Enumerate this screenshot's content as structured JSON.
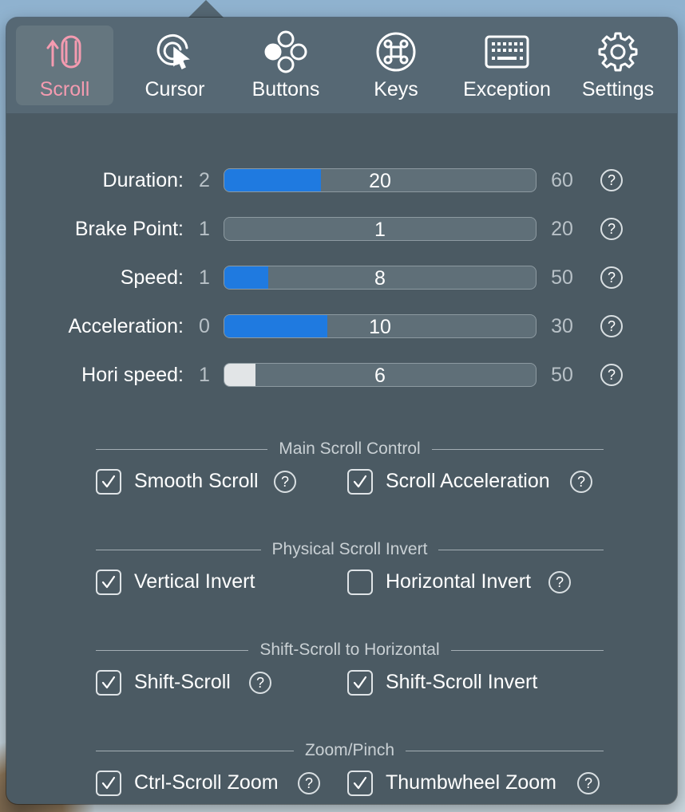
{
  "toolbar": {
    "tabs": [
      {
        "label": "Scroll",
        "icon": "scroll-icon",
        "active": true
      },
      {
        "label": "Cursor",
        "icon": "cursor-icon",
        "active": false
      },
      {
        "label": "Buttons",
        "icon": "buttons-icon",
        "active": false
      },
      {
        "label": "Keys",
        "icon": "command-key-icon",
        "active": false
      },
      {
        "label": "Exception",
        "icon": "keyboard-icon",
        "active": false
      },
      {
        "label": "Settings",
        "icon": "gear-icon",
        "active": false
      }
    ],
    "active_color": "#f49bb0"
  },
  "sliders": [
    {
      "label": "Duration:",
      "min": "2",
      "value": "20",
      "max": "60",
      "fill_color": "#1f7ae0"
    },
    {
      "label": "Brake Point:",
      "min": "1",
      "value": "1",
      "max": "20",
      "fill_color": "none"
    },
    {
      "label": "Speed:",
      "min": "1",
      "value": "8",
      "max": "50",
      "fill_color": "#1f7ae0"
    },
    {
      "label": "Acceleration:",
      "min": "0",
      "value": "10",
      "max": "30",
      "fill_color": "#1f7ae0"
    },
    {
      "label": "Hori speed:",
      "min": "1",
      "value": "6",
      "max": "50",
      "fill_color": "#e2e5e7"
    }
  ],
  "sections": [
    {
      "title": "Main Scroll Control",
      "options": [
        {
          "label": "Smooth Scroll",
          "checked": true,
          "help": true
        },
        {
          "label": "Scroll Acceleration",
          "checked": true,
          "help": true
        }
      ]
    },
    {
      "title": "Physical Scroll Invert",
      "options": [
        {
          "label": "Vertical Invert",
          "checked": true,
          "help": false
        },
        {
          "label": "Horizontal Invert",
          "checked": false,
          "help": true
        }
      ]
    },
    {
      "title": "Shift-Scroll to Horizontal",
      "options": [
        {
          "label": "Shift-Scroll",
          "checked": true,
          "help": true
        },
        {
          "label": "Shift-Scroll Invert",
          "checked": true,
          "help": false
        }
      ]
    },
    {
      "title": "Zoom/Pinch",
      "options": [
        {
          "label": "Ctrl-Scroll Zoom",
          "checked": true,
          "help": true
        },
        {
          "label": "Thumbwheel Zoom",
          "checked": true,
          "help": true
        }
      ]
    }
  ],
  "help_glyph": "?",
  "accent_color": "#1f7ae0"
}
